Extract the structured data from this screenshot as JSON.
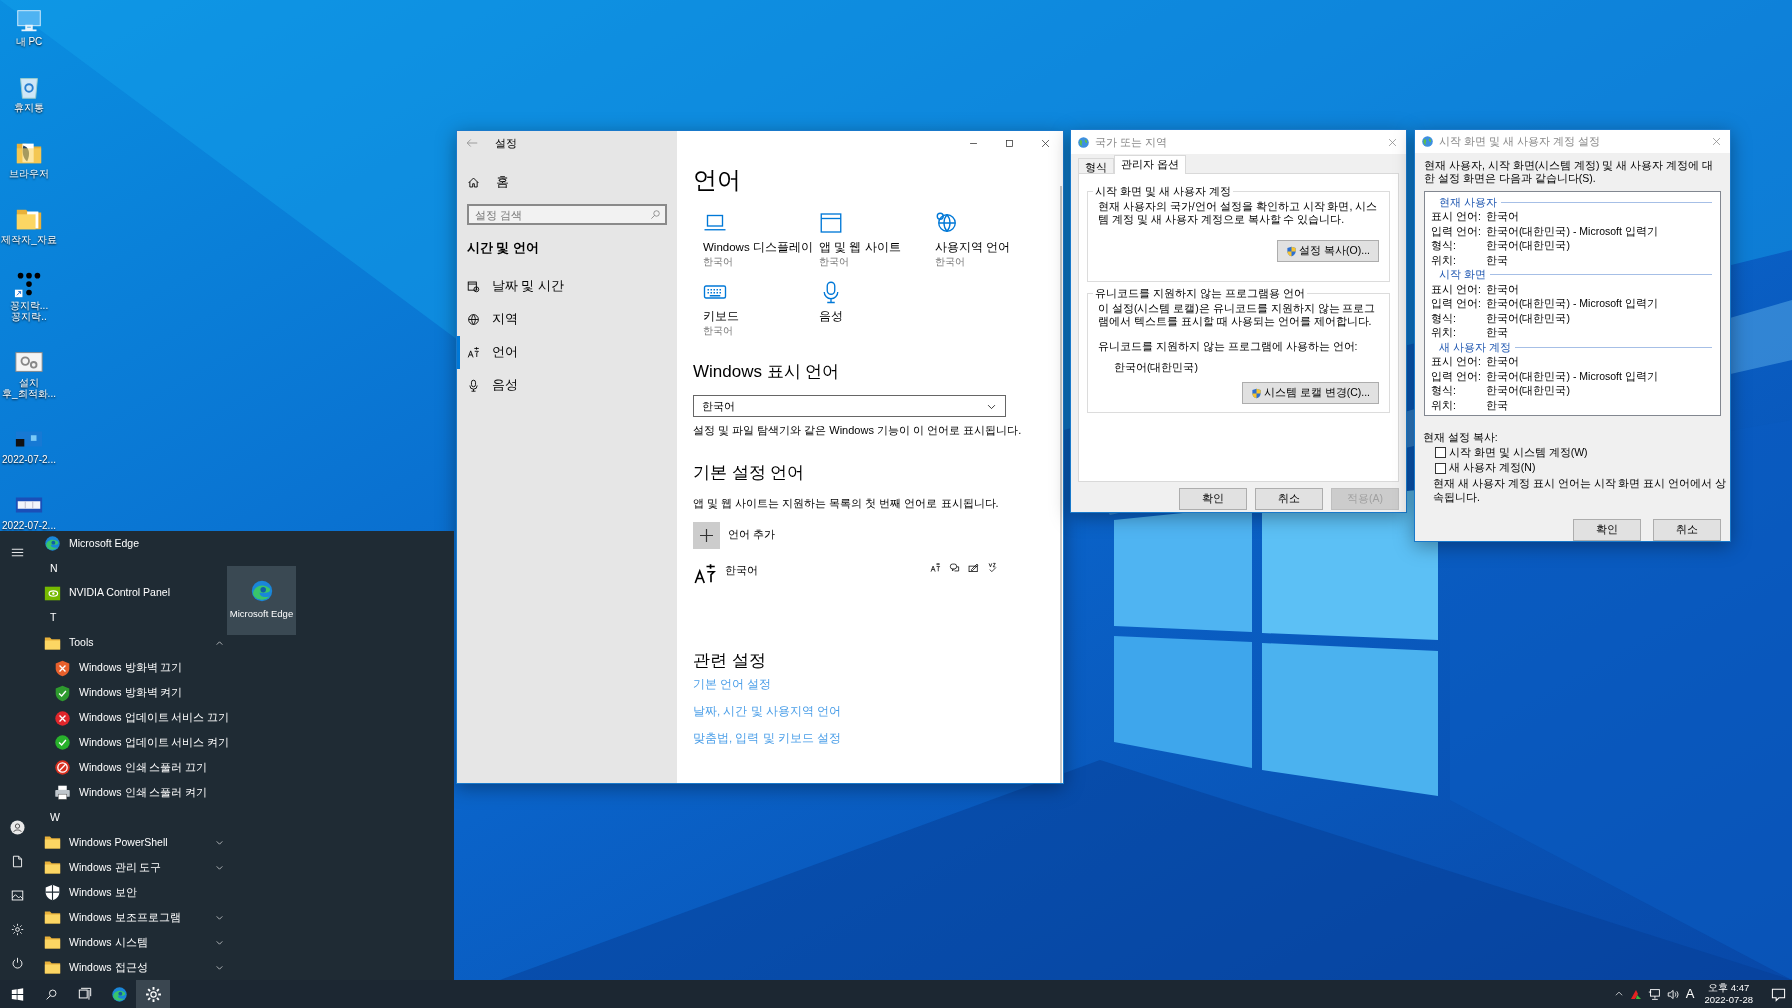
{
  "desktop_icons": [
    {
      "lines": [
        "내 PC"
      ]
    },
    {
      "lines": [
        "휴지통"
      ]
    },
    {
      "lines": [
        "브라우저"
      ]
    },
    {
      "lines": [
        "제작자_자료"
      ]
    },
    {
      "lines": [
        "꽁지락...",
        "꽁지락.."
      ]
    },
    {
      "lines": [
        "설치",
        "후_최적화..."
      ]
    },
    {
      "lines": [
        "2022-07-2..."
      ]
    },
    {
      "lines": [
        "2022-07-2..."
      ]
    }
  ],
  "settings_window": {
    "title": "설정",
    "home": "홈",
    "search_placeholder": "설정 검색",
    "section": "시간 및 언어",
    "sidebar": [
      {
        "label": "날짜 및 시간",
        "selected": false
      },
      {
        "label": "지역",
        "selected": false
      },
      {
        "label": "언어",
        "selected": true
      },
      {
        "label": "음성",
        "selected": false
      }
    ],
    "heading": "언어",
    "tiles": [
      {
        "label": "Windows 디스플레이",
        "sublabel": "한국어"
      },
      {
        "label": "앱 및 웹 사이트",
        "sublabel": "한국어"
      },
      {
        "label": "사용지역 언어",
        "sublabel": "한국어"
      },
      {
        "label": "키보드",
        "sublabel": "한국어"
      },
      {
        "label": "음성"
      }
    ],
    "display_heading": "Windows 표시 언어",
    "display_value": "한국어",
    "display_note": "설정 및 파일 탐색기와 같은 Windows 기능이 이 언어로 표시됩니다.",
    "preferred_heading": "기본 설정 언어",
    "preferred_note": "앱 및 웹 사이트는 지원하는 목록의 첫 번째 언어로 표시됩니다.",
    "add_language": "언어 추가",
    "languages": [
      {
        "name": "한국어"
      }
    ],
    "related_heading": "관련 설정",
    "related_links": [
      "기본 언어 설정",
      "날짜, 시간 및 사용지역 언어",
      "맞춤법, 입력 및 키보드 설정"
    ]
  },
  "region_dialog": {
    "title": "국가 또는 지역",
    "tabs": [
      {
        "label": "형식",
        "selected": false
      },
      {
        "label": "관리자 옵션",
        "selected": true
      }
    ],
    "groups": [
      {
        "legend": "시작 화면 및 새 사용자 계정",
        "paragraphs": [
          "현재 사용자의 국가/언어 설정을 확인하고 시작 화면, 시스템 계정 및 새 사용자 계정으로 복사할 수 있습니다."
        ],
        "button": "설정 복사(O)..."
      },
      {
        "legend": "유니코드를 지원하지 않는 프로그램용 언어",
        "paragraphs": [
          "이 설정(시스템 로캘)은 유니코드를 지원하지 않는 프로그램에서 텍스트를 표시할 때 사용되는 언어를 제어합니다.",
          "유니코드를 지원하지 않는 프로그램에 사용하는 언어:"
        ],
        "value": "한국어(대한민국)",
        "button": "시스템 로캘 변경(C)..."
      }
    ],
    "buttons": [
      {
        "label": "확인",
        "disabled": false
      },
      {
        "label": "취소",
        "disabled": false
      },
      {
        "label": "적용(A)",
        "disabled": true
      }
    ]
  },
  "copy_dialog": {
    "title": "시작 화면 및 새 사용자 계정 설정",
    "intro": "현재 사용자, 시작 화면(시스템 계정) 및 새 사용자 계정에 대한 설정 화면은 다음과 같습니다(S).",
    "sections": [
      {
        "heading": "현재 사용자",
        "rows": [
          {
            "label": "표시 언어:",
            "value": "한국어"
          },
          {
            "label": "입력 언어:",
            "value": "한국어(대한민국) - Microsoft 입력기"
          },
          {
            "label": "형식:",
            "value": "한국어(대한민국)"
          },
          {
            "label": "위치:",
            "value": "한국"
          }
        ]
      },
      {
        "heading": "시작 화면",
        "rows": [
          {
            "label": "표시 언어:",
            "value": "한국어"
          },
          {
            "label": "입력 언어:",
            "value": "한국어(대한민국) - Microsoft 입력기"
          },
          {
            "label": "형식:",
            "value": "한국어(대한민국)"
          },
          {
            "label": "위치:",
            "value": "한국"
          }
        ]
      },
      {
        "heading": "새 사용자 계정",
        "rows": [
          {
            "label": "표시 언어:",
            "value": "한국어"
          },
          {
            "label": "입력 언어:",
            "value": "한국어(대한민국) - Microsoft 입력기"
          },
          {
            "label": "형식:",
            "value": "한국어(대한민국)"
          },
          {
            "label": "위치:",
            "value": "한국"
          }
        ]
      }
    ],
    "copy_label": "현재 설정 복사:",
    "checkboxes": [
      {
        "label": "시작 화면 및 시스템 계정(W)",
        "checked": false
      },
      {
        "label": "새 사용자 계정(N)",
        "checked": false
      }
    ],
    "note": "현재 새 사용자 계정 표시 언어는 시작 화면 표시 언어에서 상속됩니다.",
    "buttons": [
      {
        "label": "확인",
        "disabled": false
      },
      {
        "label": "취소",
        "disabled": false
      }
    ]
  },
  "start_menu": {
    "entries": [
      {
        "kind": "app",
        "label": "Microsoft Edge"
      },
      {
        "kind": "letter",
        "label": "N"
      },
      {
        "kind": "app",
        "label": "NVIDIA Control Panel"
      },
      {
        "kind": "letter",
        "label": "T"
      },
      {
        "kind": "folder",
        "label": "Tools",
        "expanded": true
      },
      {
        "kind": "subapp",
        "label": "Windows 방화벽 끄기"
      },
      {
        "kind": "subapp",
        "label": "Windows 방화벽 켜기"
      },
      {
        "kind": "subapp",
        "label": "Windows 업데이트 서비스 끄기"
      },
      {
        "kind": "subapp",
        "label": "Windows 업데이트 서비스 켜기"
      },
      {
        "kind": "subapp",
        "label": "Windows 인쇄 스풀러 끄기"
      },
      {
        "kind": "subapp",
        "label": "Windows 인쇄 스풀러 켜기"
      },
      {
        "kind": "letter",
        "label": "W"
      },
      {
        "kind": "folder",
        "label": "Windows PowerShell",
        "expanded": false
      },
      {
        "kind": "folder",
        "label": "Windows 관리 도구",
        "expanded": false
      },
      {
        "kind": "app",
        "label": "Windows 보안"
      },
      {
        "kind": "folder",
        "label": "Windows 보조프로그램",
        "expanded": false
      },
      {
        "kind": "folder",
        "label": "Windows 시스템",
        "expanded": false
      },
      {
        "kind": "folder",
        "label": "Windows 접근성",
        "expanded": false
      }
    ],
    "tile": {
      "label": "Microsoft Edge"
    }
  },
  "taskbar": {
    "apps": [
      {
        "active": false
      },
      {
        "active": true
      }
    ],
    "ime": "A",
    "time": "오후 4:47",
    "date": "2022-07-28"
  }
}
